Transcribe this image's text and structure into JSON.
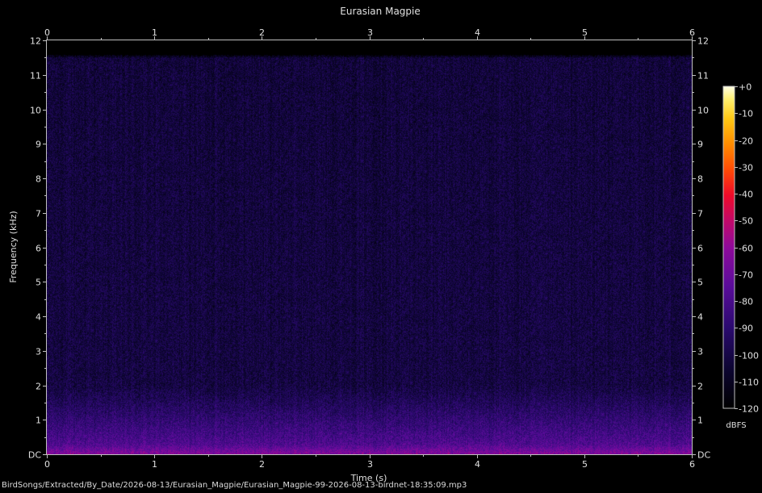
{
  "chart_data": {
    "type": "heatmap",
    "title": "Eurasian Magpie",
    "xlabel": "Time (s)",
    "ylabel": "Frequency (kHz)",
    "xlim": [
      0,
      6
    ],
    "ylim": [
      0,
      12
    ],
    "x_ticks": [
      "0",
      "1",
      "2",
      "3",
      "4",
      "5",
      "6"
    ],
    "y_ticks": [
      "DC",
      "1",
      "2",
      "3",
      "4",
      "5",
      "6",
      "7",
      "8",
      "9",
      "10",
      "11",
      "12"
    ],
    "colorbar": {
      "label": "dBFS",
      "range": [
        -120,
        0
      ],
      "ticks": [
        "+0",
        "-10",
        "-20",
        "-30",
        "-40",
        "-50",
        "-60",
        "-70",
        "-80",
        "-90",
        "-100",
        "-110",
        "-120"
      ]
    },
    "signal_max_khz": 11.6,
    "energy_profile": [
      {
        "khz": 0.0,
        "dbfs": -62
      },
      {
        "khz": 0.3,
        "dbfs": -78
      },
      {
        "khz": 1.0,
        "dbfs": -88
      },
      {
        "khz": 1.5,
        "dbfs": -95
      },
      {
        "khz": 2.0,
        "dbfs": -101
      },
      {
        "khz": 11.5,
        "dbfs": -103
      },
      {
        "khz": 11.6,
        "dbfs": -120
      }
    ]
  },
  "footer": {
    "file_path": "BirdSongs/Extracted/By_Date/2026-08-13/Eurasian_Magpie/Eurasian_Magpie-99-2026-08-13-birdnet-18:35:09.mp3"
  },
  "colors": {
    "background": "#000000",
    "axis": "#bfbfbf",
    "text": "#e0e0e0"
  }
}
